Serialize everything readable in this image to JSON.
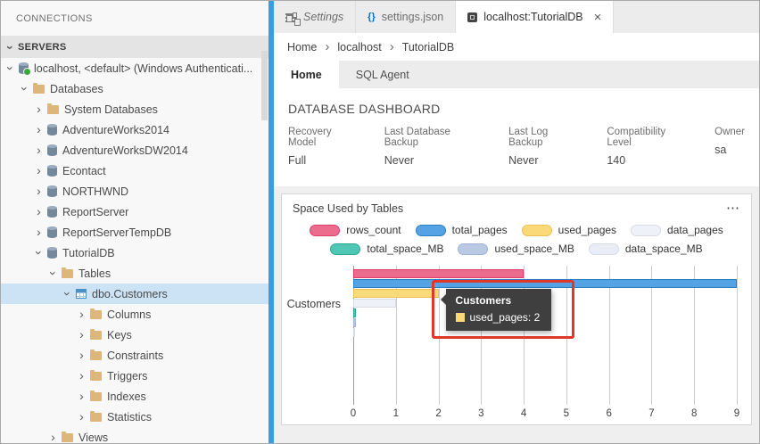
{
  "colors": {
    "accent_blue": "#3a9ce2",
    "annotation_red": "#e0372b",
    "selected_row": "#cbe3f5",
    "tooltip_bg": "#3f3f3f"
  },
  "icons": {
    "braces": "{}",
    "close": "×",
    "chevron": "›",
    "ellipsis": "⋯"
  },
  "sidebar": {
    "title": "CONNECTIONS",
    "section_label": "SERVERS",
    "tree": [
      {
        "label": "localhost, <default> (Windows Authenticati...",
        "level": 0,
        "expanded": true,
        "icon": "server",
        "selected": false
      },
      {
        "label": "Databases",
        "level": 1,
        "expanded": true,
        "icon": "folder",
        "selected": false
      },
      {
        "label": "System Databases",
        "level": 2,
        "expanded": false,
        "icon": "folder",
        "selected": false
      },
      {
        "label": "AdventureWorks2014",
        "level": 2,
        "expanded": false,
        "icon": "database",
        "selected": false
      },
      {
        "label": "AdventureWorksDW2014",
        "level": 2,
        "expanded": false,
        "icon": "database",
        "selected": false
      },
      {
        "label": "Econtact",
        "level": 2,
        "expanded": false,
        "icon": "database",
        "selected": false
      },
      {
        "label": "NORTHWND",
        "level": 2,
        "expanded": false,
        "icon": "database",
        "selected": false
      },
      {
        "label": "ReportServer",
        "level": 2,
        "expanded": false,
        "icon": "database",
        "selected": false
      },
      {
        "label": "ReportServerTempDB",
        "level": 2,
        "expanded": false,
        "icon": "database",
        "selected": false
      },
      {
        "label": "TutorialDB",
        "level": 2,
        "expanded": true,
        "icon": "database",
        "selected": false
      },
      {
        "label": "Tables",
        "level": 3,
        "expanded": true,
        "icon": "folder",
        "selected": false
      },
      {
        "label": "dbo.Customers",
        "level": 4,
        "expanded": true,
        "icon": "table",
        "selected": true
      },
      {
        "label": "Columns",
        "level": 5,
        "expanded": false,
        "icon": "folder",
        "selected": false
      },
      {
        "label": "Keys",
        "level": 5,
        "expanded": false,
        "icon": "folder",
        "selected": false
      },
      {
        "label": "Constraints",
        "level": 5,
        "expanded": false,
        "icon": "folder",
        "selected": false
      },
      {
        "label": "Triggers",
        "level": 5,
        "expanded": false,
        "icon": "folder",
        "selected": false
      },
      {
        "label": "Indexes",
        "level": 5,
        "expanded": false,
        "icon": "folder",
        "selected": false
      },
      {
        "label": "Statistics",
        "level": 5,
        "expanded": false,
        "icon": "folder",
        "selected": false
      },
      {
        "label": "Views",
        "level": 3,
        "expanded": false,
        "icon": "folder",
        "selected": false
      }
    ]
  },
  "editor_tabs": [
    {
      "label": "Settings"
    },
    {
      "label": "settings.json"
    },
    {
      "label": "localhost:TutorialDB"
    }
  ],
  "breadcrumb": [
    "Home",
    "localhost",
    "TutorialDB"
  ],
  "dashboard_tabs": [
    "Home",
    "SQL Agent"
  ],
  "dashboard": {
    "title": "DATABASE DASHBOARD",
    "properties": [
      {
        "label": "Recovery Model",
        "value": "Full"
      },
      {
        "label": "Last Database Backup",
        "value": "Never"
      },
      {
        "label": "Last Log Backup",
        "value": "Never"
      },
      {
        "label": "Compatibility Level",
        "value": "140"
      },
      {
        "label": "Owner",
        "value": "sa"
      }
    ]
  },
  "widget": {
    "title": "Space Used by Tables"
  },
  "tooltip": {
    "title": "Customers",
    "series": "used_pages",
    "text": "used_pages: 2"
  },
  "chart_data": {
    "type": "bar",
    "orientation": "horizontal",
    "title": "Space Used by Tables",
    "categories": [
      "Customers"
    ],
    "series": [
      {
        "name": "rows_count",
        "values": [
          4
        ],
        "color": "#ec6c8d",
        "border": "#e23a68"
      },
      {
        "name": "total_pages",
        "values": [
          9
        ],
        "color": "#55a3e4",
        "border": "#2a7fc2"
      },
      {
        "name": "used_pages",
        "values": [
          2
        ],
        "color": "#f9d978",
        "border": "#ecc052"
      },
      {
        "name": "data_pages",
        "values": [
          1
        ],
        "color": "#eff1f9",
        "border": "#d9dce8"
      },
      {
        "name": "total_space_MB",
        "values": [
          0.07
        ],
        "color": "#4fc7b4",
        "border": "#2aa893"
      },
      {
        "name": "used_space_MB",
        "values": [
          0.06
        ],
        "color": "#bac9e3",
        "border": "#9fb3d6"
      },
      {
        "name": "data_space_MB",
        "values": [
          0.05
        ],
        "color": "#eaedf6",
        "border": "#d5dae9"
      }
    ],
    "xlim": [
      0,
      9
    ],
    "xticks": [
      0,
      1,
      2,
      3,
      4,
      5,
      6,
      7,
      8,
      9
    ],
    "grid": true,
    "legend_position": "top"
  }
}
